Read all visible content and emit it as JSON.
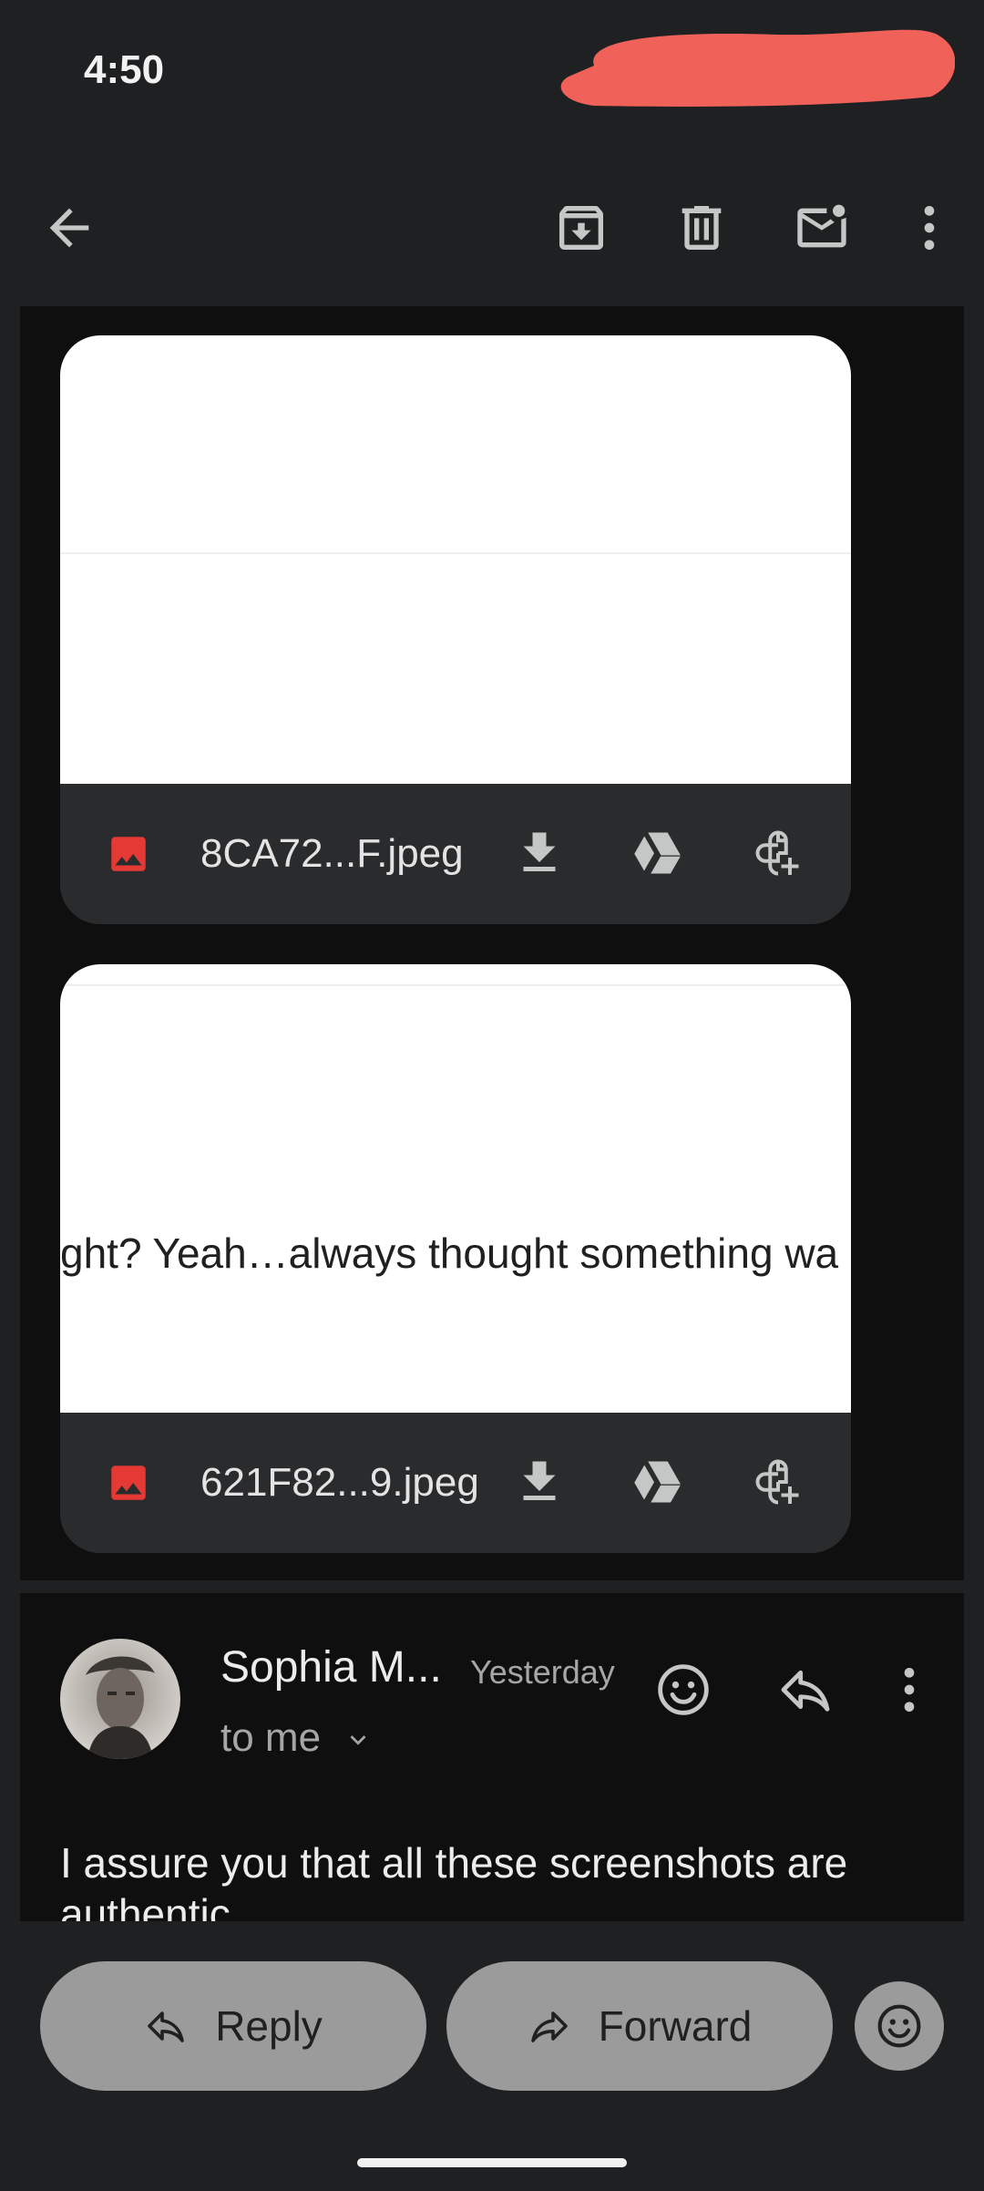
{
  "status_bar": {
    "time": "4:50"
  },
  "toolbar": {
    "back_icon": "arrow-back-icon",
    "archive_icon": "archive-icon",
    "delete_icon": "trash-icon",
    "mark_unread_icon": "mail-unread-icon",
    "more_icon": "more-vert-icon"
  },
  "attachments": [
    {
      "filename": "8CA72...F.jpeg",
      "preview_text": ""
    },
    {
      "filename": "621F82...9.jpeg",
      "preview_text": "ght? Yeah…always thought something wa"
    }
  ],
  "message": {
    "sender": "Sophia M...",
    "date": "Yesterday",
    "recipient": "to me",
    "body": "I assure you that all these screenshots are authentic"
  },
  "actions": {
    "reply_label": "Reply",
    "forward_label": "Forward"
  },
  "colors": {
    "background": "#1f2021",
    "content_background": "#0f0f0f",
    "attachment_image_icon": "#e53935",
    "redaction": "#ef6159",
    "button": "#9b9b9b"
  }
}
